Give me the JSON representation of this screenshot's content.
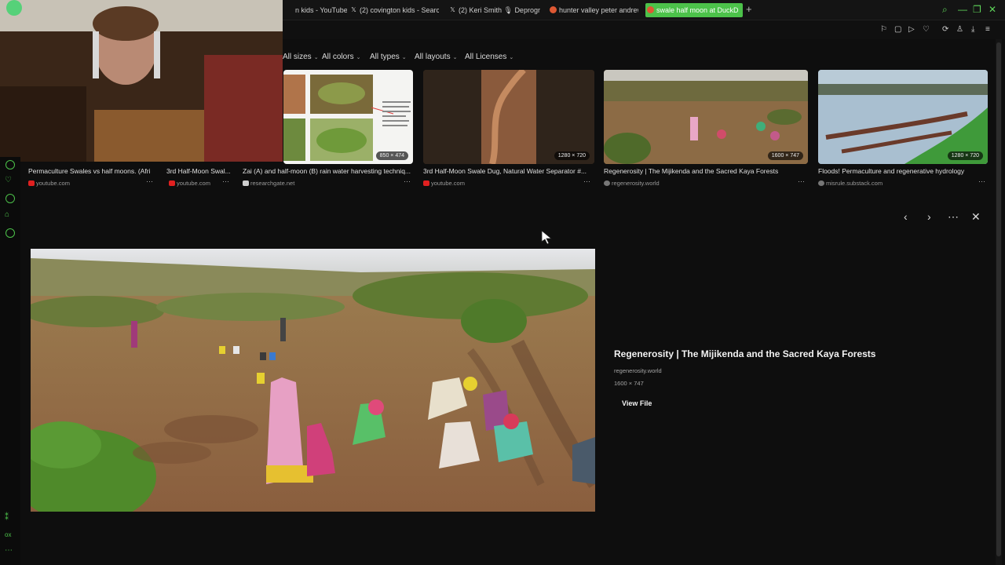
{
  "tabs": [
    {
      "label": "n kids - YouTube",
      "icon": "youtube-icon",
      "active": false
    },
    {
      "label": "(2) covington kids - Searc",
      "icon": "x-icon",
      "active": false
    },
    {
      "label": "(2) Keri Smith 🎙 Deprogr",
      "icon": "x-icon",
      "active": false
    },
    {
      "label": "hunter valley peter andrew",
      "icon": "duckduckgo-icon",
      "active": false
    },
    {
      "label": "swale half moon at DuckD",
      "icon": "duckduckgo-icon",
      "active": true
    }
  ],
  "new_tab_label": "+",
  "filters": [
    {
      "label": "All sizes"
    },
    {
      "label": "All colors"
    },
    {
      "label": "All types"
    },
    {
      "label": "All layouts"
    },
    {
      "label": "All Licenses"
    }
  ],
  "results": [
    {
      "caption": "Permaculture Swales vs half moons. (Afri",
      "source": "youtube.com",
      "source_color": "#e02020",
      "dims": ""
    },
    {
      "caption": "3rd Half-Moon Swal...",
      "source": "youtube.com",
      "source_color": "#e02020",
      "dims": ""
    },
    {
      "caption": "Zai (A) and half-moon (B) rain water harvesting techniq...",
      "source": "researchgate.net",
      "source_color": "#cfcfcf",
      "dims": "850 × 474"
    },
    {
      "caption": "3rd Half-Moon Swale Dug, Natural Water Separator #...",
      "source": "youtube.com",
      "source_color": "#e02020",
      "dims": "1280 × 720"
    },
    {
      "caption": "Regenerosity | The Mijikenda and the Sacred Kaya Forests",
      "source": "regenerosity.world",
      "source_color": "#777777",
      "dims": "1600 × 747"
    },
    {
      "caption": "Floods! Permaculture and regenerative hydrology",
      "source": "misrule.substack.com",
      "source_color": "#777777",
      "dims": "1280 × 720"
    }
  ],
  "more_label": "⋯",
  "detail": {
    "title": "Regenerosity | The Mijikenda and the Sacred Kaya Forests",
    "domain": "regenerosity.world",
    "size": "1600 × 747",
    "view_file": "View File",
    "prev": "‹",
    "next": "›",
    "more": "⋯",
    "close": "✕"
  },
  "sidebar_bottom": {
    "label_1": "⁑",
    "label_2": "ox",
    "label_3": "⋯"
  },
  "colors": {
    "accent": "#4cc24a",
    "background": "#0e0e0e",
    "youtube": "#e02020"
  }
}
